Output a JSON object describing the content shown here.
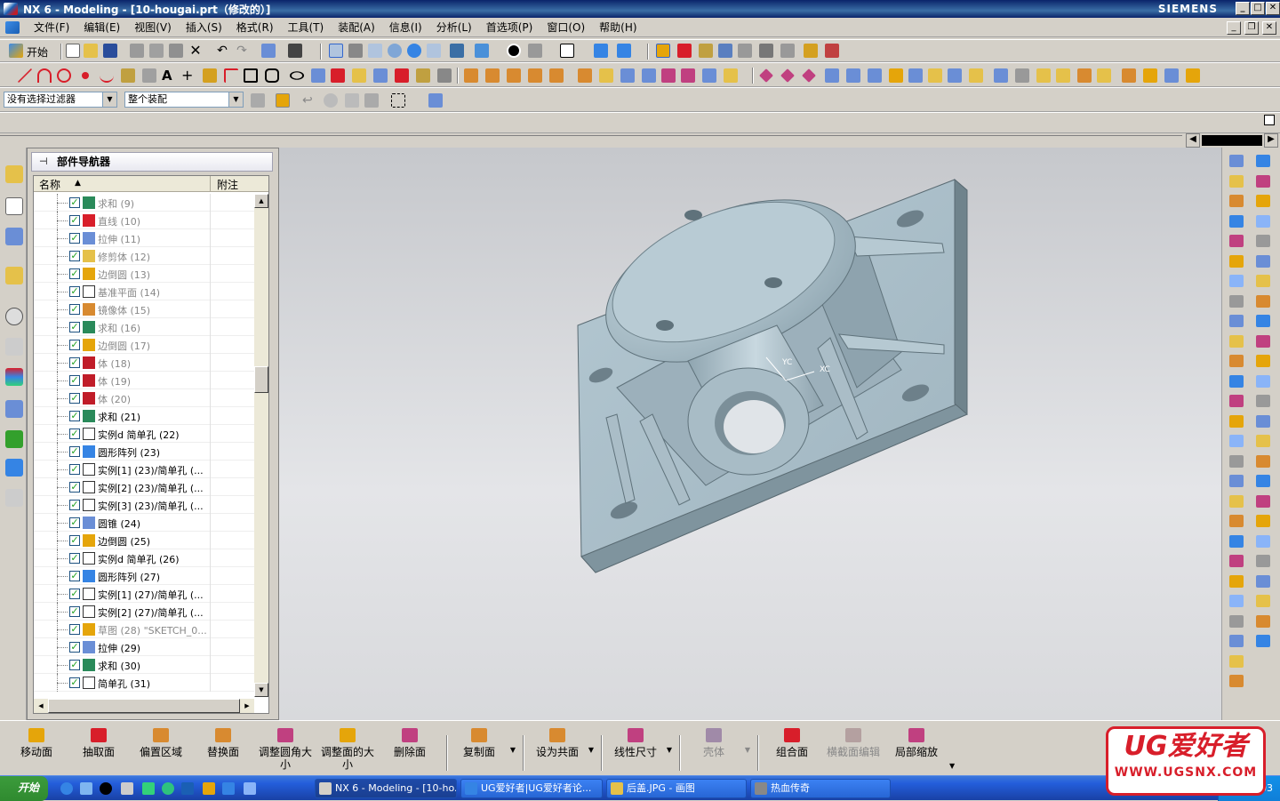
{
  "window": {
    "title": "NX 6 - Modeling - [10-hougai.prt（修改的）]",
    "brand": "SIEMENS",
    "controls": [
      "_",
      "□",
      "✕"
    ]
  },
  "menubar": {
    "items": [
      "文件(F)",
      "编辑(E)",
      "视图(V)",
      "插入(S)",
      "格式(R)",
      "工具(T)",
      "装配(A)",
      "信息(I)",
      "分析(L)",
      "首选项(P)",
      "窗口(O)",
      "帮助(H)"
    ]
  },
  "toolbar": {
    "start_label": "开始",
    "filter_value": "没有选择过滤器",
    "assembly_value": "整个装配"
  },
  "navigator": {
    "title": "部件导航器",
    "col_name": "名称",
    "col_attach": "附注",
    "items": [
      {
        "label": "求和 (9)",
        "icon": "unite-icon",
        "dim": true
      },
      {
        "label": "直线 (10)",
        "icon": "line-icon",
        "dim": true
      },
      {
        "label": "拉伸 (11)",
        "icon": "extrude-icon",
        "dim": true
      },
      {
        "label": "修剪体 (12)",
        "icon": "trim-body-icon",
        "dim": true
      },
      {
        "label": "边倒圆 (13)",
        "icon": "edge-blend-icon",
        "dim": true
      },
      {
        "label": "基准平面 (14)",
        "icon": "datum-plane-icon",
        "dim": true
      },
      {
        "label": "镜像体 (15)",
        "icon": "mirror-body-icon",
        "dim": true
      },
      {
        "label": "求和 (16)",
        "icon": "unite-icon",
        "dim": true
      },
      {
        "label": "边倒圆 (17)",
        "icon": "edge-blend-icon",
        "dim": true
      },
      {
        "label": "体 (18)",
        "icon": "body-icon",
        "dim": true
      },
      {
        "label": "体 (19)",
        "icon": "body-icon",
        "dim": true
      },
      {
        "label": "体 (20)",
        "icon": "body-icon",
        "dim": true
      },
      {
        "label": "求和 (21)",
        "icon": "unite-icon",
        "dim": false
      },
      {
        "label": "实例d 简单孔 (22)",
        "icon": "hole-icon",
        "dim": false
      },
      {
        "label": "圆形阵列 (23)",
        "icon": "circular-array-icon",
        "dim": false
      },
      {
        "label": "实例[1] (23)/简单孔 (...",
        "icon": "hole-icon",
        "dim": false
      },
      {
        "label": "实例[2] (23)/简单孔 (...",
        "icon": "hole-icon",
        "dim": false
      },
      {
        "label": "实例[3] (23)/简单孔 (...",
        "icon": "hole-icon",
        "dim": false
      },
      {
        "label": "圆锥 (24)",
        "icon": "cone-icon",
        "dim": false
      },
      {
        "label": "边倒圆 (25)",
        "icon": "edge-blend-icon",
        "dim": false
      },
      {
        "label": "实例d 简单孔 (26)",
        "icon": "hole-icon",
        "dim": false
      },
      {
        "label": "圆形阵列 (27)",
        "icon": "circular-array-icon",
        "dim": false
      },
      {
        "label": "实例[1] (27)/简单孔 (...",
        "icon": "hole-icon",
        "dim": false
      },
      {
        "label": "实例[2] (27)/简单孔 (...",
        "icon": "hole-icon",
        "dim": false
      },
      {
        "label": "草图 (28) \"SKETCH_0...",
        "icon": "sketch-icon",
        "dim": true
      },
      {
        "label": "拉伸 (29)",
        "icon": "extrude-icon",
        "dim": false
      },
      {
        "label": "求和 (30)",
        "icon": "unite-icon",
        "dim": false
      },
      {
        "label": "简单孔 (31)",
        "icon": "hole-icon",
        "dim": false
      }
    ]
  },
  "viewport": {
    "axis_labels": [
      "YC",
      "XC"
    ]
  },
  "bottombar": {
    "items": [
      {
        "label": "移动面",
        "disabled": false
      },
      {
        "label": "抽取面",
        "disabled": false
      },
      {
        "label": "偏置区域",
        "disabled": false
      },
      {
        "label": "替换面",
        "disabled": false
      },
      {
        "label": "调整圆角大小",
        "disabled": false
      },
      {
        "label": "调整面的大小",
        "disabled": false
      },
      {
        "label": "删除面",
        "disabled": false
      },
      {
        "label": "复制面",
        "disabled": false
      },
      {
        "label": "设为共面",
        "disabled": false
      },
      {
        "label": "线性尺寸",
        "disabled": false
      },
      {
        "label": "壳体",
        "disabled": true
      },
      {
        "label": "组合面",
        "disabled": false
      },
      {
        "label": "横截面编辑",
        "disabled": true
      },
      {
        "label": "局部缩放",
        "disabled": false
      }
    ]
  },
  "taskbar": {
    "start_label": "开始",
    "tasks": [
      {
        "label": "NX 6 - Modeling - [10-ho...",
        "active": true
      },
      {
        "label": "UG爱好者|UG爱好者论...",
        "active": false
      },
      {
        "label": "后盖.JPG - 画图",
        "active": false
      },
      {
        "label": "热血传奇",
        "active": false
      }
    ],
    "clock": "17:03"
  },
  "watermark": {
    "big": "UG爱好者",
    "small": "WWW.UGSNX.COM"
  },
  "colors": {
    "title_bar": "#0a246a",
    "model": "#a9bcc6",
    "watermark": "#d81e2a",
    "check": "#21a121"
  }
}
